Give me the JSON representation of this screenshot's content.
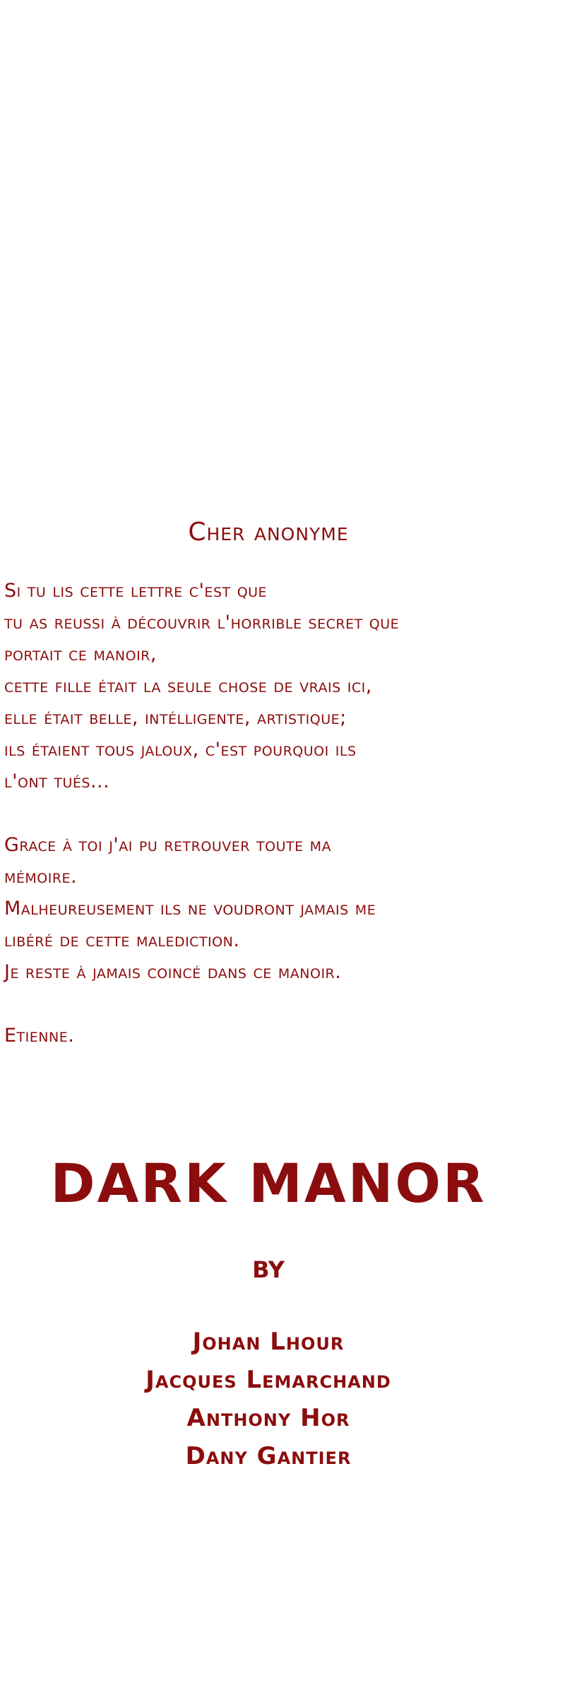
{
  "letter": {
    "greeting": "Cher anonyme",
    "lines": [
      "Si tu lis cette lettre c'est que",
      "tu as reussi à découvrir l'horrible secret que",
      "portait ce manoir,",
      " cette fille était la seule chose de vrais ici,",
      "elle était belle, intélligente, artistique;",
      "ils étaient tous jaloux, c'est pourquoi ils",
      "l'ont tués...",
      "Grace à toi j'ai pu retrouver toute ma",
      "mémoire.",
      "Malheureusement ils ne voudront jamais me",
      "libéré de cette malediction.",
      "Je reste à jamais coincé dans ce manoir.",
      "Etienne."
    ]
  },
  "credits": {
    "title": "DARK MANOR",
    "by": "BY",
    "names": [
      "Johan Lhour",
      "Jacques Lemarchand",
      "Anthony Hor",
      "Dany Gantier"
    ]
  },
  "colors": {
    "text": "#8b0d0d",
    "background": "#ffffff"
  }
}
